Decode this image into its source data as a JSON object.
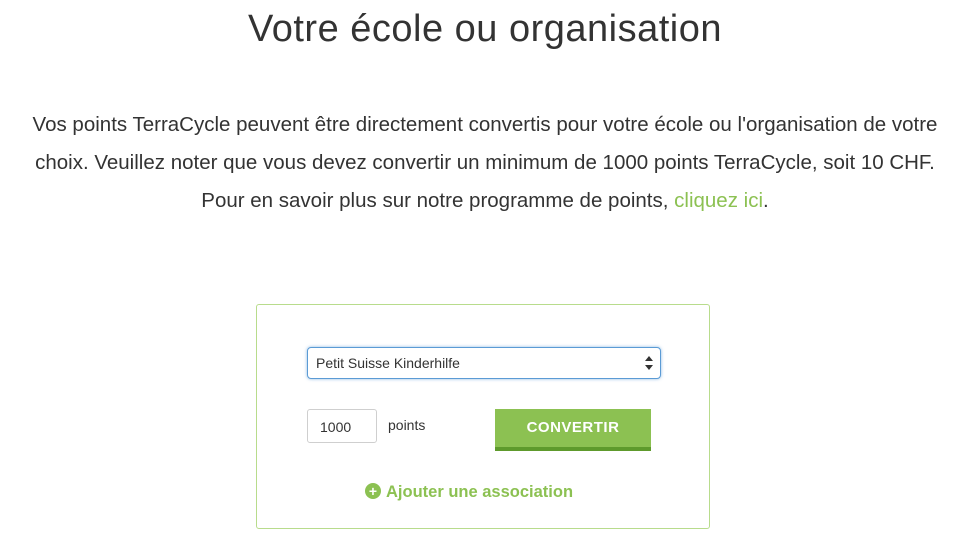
{
  "page": {
    "title": "Votre école ou organisation"
  },
  "intro": {
    "text_before_link": "Vos points TerraCycle peuvent être directement convertis pour votre école ou l'organisation de votre choix. Veuillez noter que vous devez convertir un minimum de 1000 points TerraCycle, soit 10 CHF. Pour en savoir plus sur notre programme de points, ",
    "link_text": "cliquez ici",
    "text_after_link": "."
  },
  "form": {
    "organisation_select": {
      "selected": "Petit Suisse Kinderhilfe"
    },
    "points_input": {
      "value": "1000"
    },
    "points_label": "points",
    "convert_button": "CONVERTIR",
    "add_association": {
      "label": "Ajouter une association",
      "icon": "plus-circle-icon"
    }
  },
  "colors": {
    "accent_green": "#8cc152",
    "button_shadow": "#5e9a2c",
    "card_border": "#b8dc8c",
    "focus_blue": "#5b9bd5"
  }
}
